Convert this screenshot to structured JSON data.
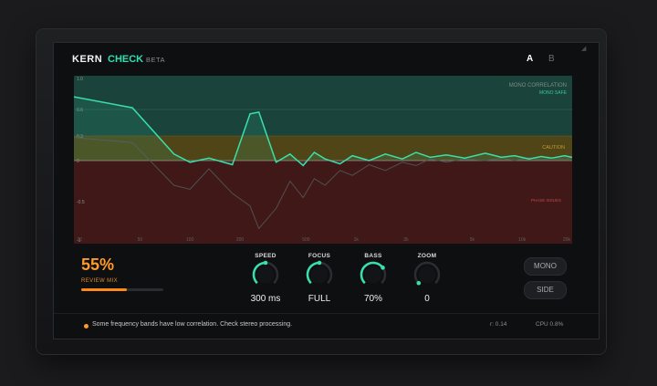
{
  "header": {
    "brand": "KERN",
    "product": "CHECK",
    "badge": "BETA",
    "ab": [
      "A",
      "B"
    ]
  },
  "graph": {
    "y_ticks": [
      "1.0",
      "0.6",
      "0.3",
      "0",
      "-0.5",
      "-1"
    ],
    "x_ticks": [
      "20",
      "50",
      "100",
      "200",
      "500",
      "1k",
      "2k",
      "5k",
      "10k",
      "20k"
    ],
    "zones": {
      "title": "MONO CORRELATION",
      "mono_safe": "MONO SAFE",
      "caution": "CAUTION",
      "phase_issues": "PHASE ISSUES"
    },
    "colors": {
      "mono_safe": "#1f5a4d",
      "caution": "#6a5a1a",
      "phase": "#5a1f1f",
      "line_primary": "#39e0ab",
      "line_secondary": "#4a4c4d"
    }
  },
  "chart_data": {
    "type": "line",
    "xlabel": "",
    "ylabel": "",
    "ylim": [
      -1,
      1
    ],
    "series": [
      {
        "points": [
          [
            20,
            0.75
          ],
          [
            45,
            0.62
          ],
          [
            80,
            0.08
          ],
          [
            100,
            -0.02
          ],
          [
            130,
            0.03
          ],
          [
            180,
            -0.05
          ],
          [
            230,
            0.55
          ],
          [
            260,
            0.57
          ],
          [
            330,
            -0.02
          ],
          [
            400,
            0.08
          ],
          [
            480,
            -0.06
          ],
          [
            560,
            0.1
          ],
          [
            650,
            0.02
          ],
          [
            800,
            -0.04
          ],
          [
            950,
            0.06
          ],
          [
            1200,
            0.0
          ],
          [
            1500,
            0.08
          ],
          [
            1900,
            0.02
          ],
          [
            2300,
            0.1
          ],
          [
            2800,
            0.04
          ],
          [
            3500,
            0.07
          ],
          [
            4500,
            0.03
          ],
          [
            6000,
            0.09
          ],
          [
            7500,
            0.04
          ],
          [
            9000,
            0.06
          ],
          [
            11000,
            0.02
          ],
          [
            13000,
            0.05
          ],
          [
            15000,
            0.03
          ],
          [
            18000,
            0.06
          ],
          [
            20000,
            0.04
          ]
        ]
      },
      {
        "points": [
          [
            20,
            0.28
          ],
          [
            45,
            0.22
          ],
          [
            80,
            -0.3
          ],
          [
            100,
            -0.35
          ],
          [
            130,
            -0.1
          ],
          [
            180,
            -0.4
          ],
          [
            230,
            -0.55
          ],
          [
            260,
            -0.82
          ],
          [
            330,
            -0.58
          ],
          [
            400,
            -0.25
          ],
          [
            480,
            -0.45
          ],
          [
            560,
            -0.22
          ],
          [
            650,
            -0.3
          ],
          [
            800,
            -0.12
          ],
          [
            950,
            -0.18
          ],
          [
            1200,
            -0.05
          ],
          [
            1500,
            -0.12
          ],
          [
            1900,
            -0.02
          ],
          [
            2300,
            -0.06
          ],
          [
            2800,
            0.02
          ],
          [
            3500,
            -0.02
          ],
          [
            4500,
            0.02
          ],
          [
            6000,
            0.0
          ],
          [
            7500,
            0.03
          ],
          [
            9000,
            0.0
          ],
          [
            11000,
            0.04
          ],
          [
            13000,
            0.01
          ],
          [
            15000,
            0.03
          ],
          [
            18000,
            0.02
          ],
          [
            20000,
            0.03
          ]
        ]
      }
    ]
  },
  "review_mix": {
    "value": "55%",
    "label": "REVIEW MIX",
    "fraction": 0.55
  },
  "knobs": [
    {
      "label": "SPEED",
      "value": "300 ms",
      "level": 0.5
    },
    {
      "label": "FOCUS",
      "value": "FULL",
      "level": 0.5
    },
    {
      "label": "BASS",
      "value": "70%",
      "level": 0.7
    },
    {
      "label": "ZOOM",
      "value": "0",
      "level": 0.0
    }
  ],
  "mode_buttons": [
    "MONO",
    "SIDE"
  ],
  "status": {
    "message": "Some frequency bands have low correlation. Check stereo processing.",
    "r": "r: 0.14",
    "cpu": "CPU  0.8%"
  },
  "colors": {
    "accent": "#2fe0b0",
    "warning": "#ff9a2a",
    "knob_accent": "#39e0ab"
  }
}
